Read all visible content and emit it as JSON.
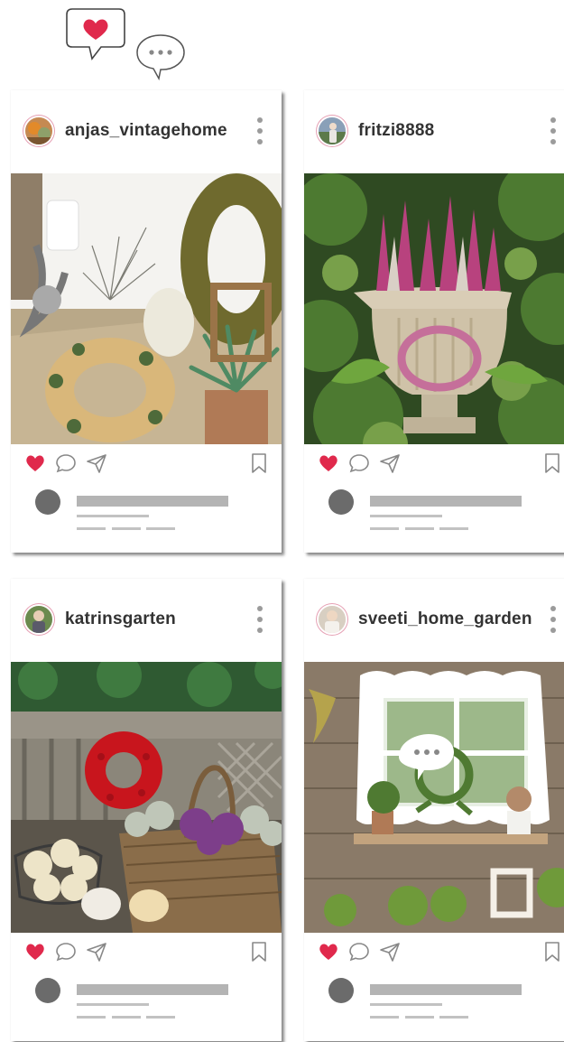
{
  "decoration": {
    "heart_bubble_icon": "heart-speech-bubble",
    "dots_bubble_icon": "ellipsis-speech-bubble"
  },
  "colors": {
    "like_red": "#e0294c",
    "placeholder_grey": "#c8c8c8",
    "avatar_grey": "#6b6b6b"
  },
  "posts": [
    {
      "username": "anjas_vintagehome",
      "liked": true,
      "photo": "autumn-wreaths-table",
      "actions": [
        "heart-icon",
        "comment-icon",
        "share-icon",
        "bookmark-icon"
      ]
    },
    {
      "username": "fritzi8888",
      "liked": true,
      "photo": "heather-urn-garden",
      "actions": [
        "heart-icon",
        "comment-icon",
        "share-icon",
        "bookmark-icon"
      ]
    },
    {
      "username": "katrinsgarten",
      "liked": true,
      "photo": "bench-wreath-pumpkins",
      "actions": [
        "heart-icon",
        "comment-icon",
        "share-icon",
        "bookmark-icon"
      ]
    },
    {
      "username": "sveeti_home_garden",
      "liked": true,
      "photo": "window-wreath-wall",
      "actions": [
        "heart-icon",
        "comment-icon",
        "share-icon",
        "bookmark-icon"
      ]
    }
  ]
}
